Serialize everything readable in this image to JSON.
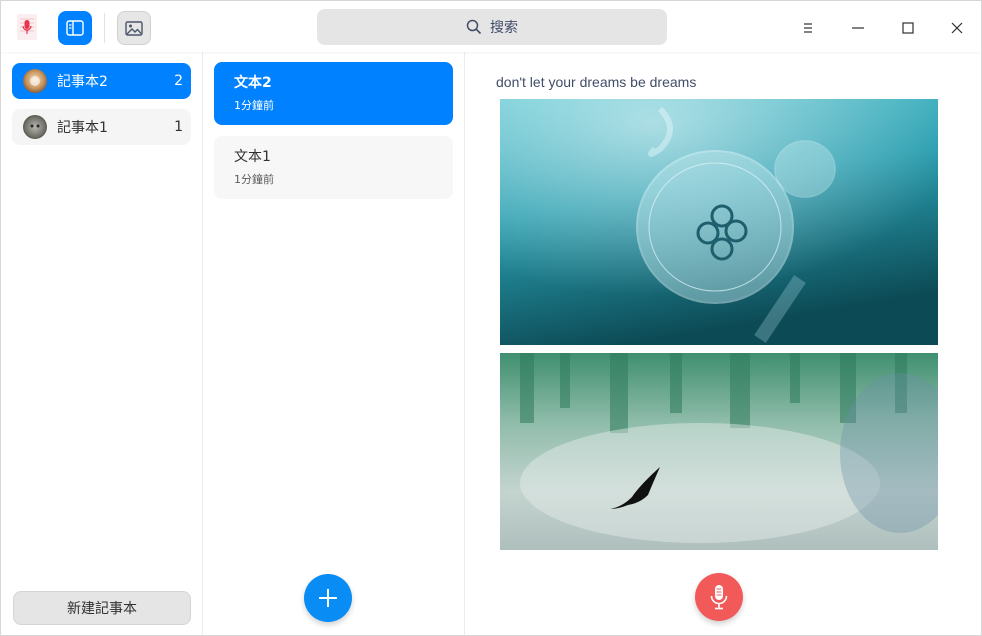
{
  "search": {
    "label": "搜索",
    "icon": "search-icon"
  },
  "notebooks": [
    {
      "name": "記事本2",
      "count": "2",
      "active": true
    },
    {
      "name": "記事本1",
      "count": "1",
      "active": false
    }
  ],
  "new_notebook_label": "新建記事本",
  "notes": [
    {
      "title": "文本2",
      "time": "1分鐘前",
      "active": true
    },
    {
      "title": "文本1",
      "time": "1分鐘前",
      "active": false
    }
  ],
  "editor": {
    "text": "don't let your dreams be dreams"
  },
  "colors": {
    "accent": "#0081ff",
    "record": "#f25a5a",
    "search_bg": "#e5e5e5"
  }
}
